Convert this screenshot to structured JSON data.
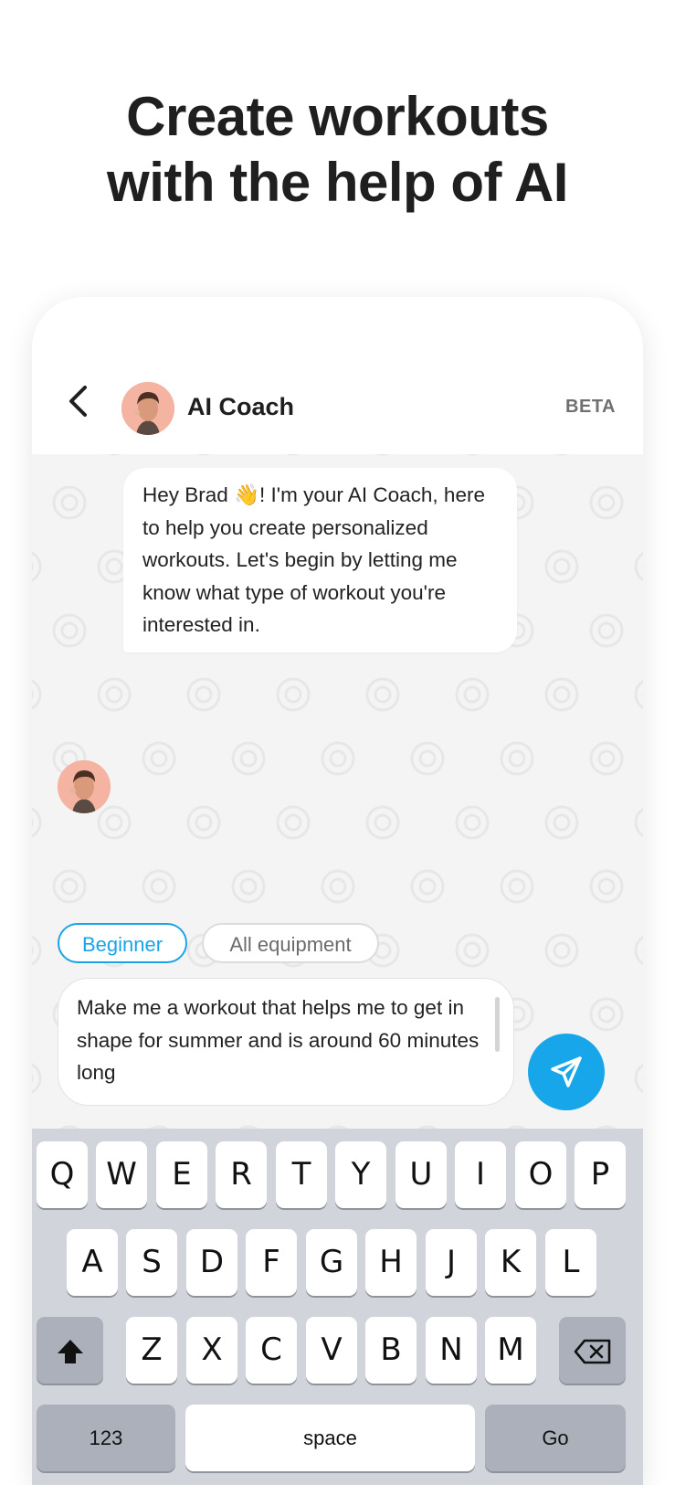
{
  "headline": {
    "line1": "Create workouts",
    "line2": "with the help of AI"
  },
  "header": {
    "back_icon": "chevron-left-icon",
    "coach_name": "AI Coach",
    "badge": "BETA"
  },
  "messages": [
    {
      "sender": "AI Coach",
      "text": "Hey Brad 👋! I'm your AI Coach, here to help you create personalized workouts. Let's begin by letting me know what type of workout you're interested in."
    }
  ],
  "chips": [
    {
      "label": "Beginner",
      "selected": true
    },
    {
      "label": "All equipment",
      "selected": false
    }
  ],
  "composer": {
    "value": "Make me a workout that helps me to get in shape for summer and is around 60 minutes long",
    "send_icon": "paper-plane-icon"
  },
  "keyboard": {
    "row1": [
      "Q",
      "W",
      "E",
      "R",
      "T",
      "Y",
      "U",
      "I",
      "O",
      "P"
    ],
    "row2": [
      "A",
      "S",
      "D",
      "F",
      "G",
      "H",
      "J",
      "K",
      "L"
    ],
    "row3": [
      "Z",
      "X",
      "C",
      "V",
      "B",
      "N",
      "M"
    ],
    "shift_icon": "shift-arrow-icon",
    "backspace_icon": "backspace-icon",
    "numbers_label": "123",
    "space_label": "space",
    "go_label": "Go"
  },
  "colors": {
    "accent": "#18a6ea",
    "chip_selected": "#1aa4e8",
    "avatar_bg": "#f5b3a2",
    "keyboard_bg": "#d1d4db"
  }
}
